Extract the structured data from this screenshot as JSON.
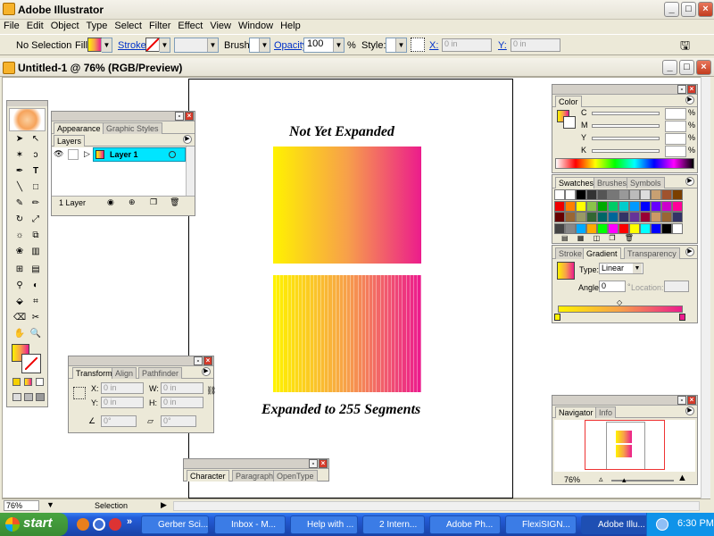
{
  "app": {
    "title": "Adobe Illustrator"
  },
  "menu": [
    "File",
    "Edit",
    "Object",
    "Type",
    "Select",
    "Filter",
    "Effect",
    "View",
    "Window",
    "Help"
  ],
  "control_bar": {
    "selection": "No Selection",
    "fill_label": "Fill:",
    "stroke_label": "Stroke:",
    "brush_label": "Brush:",
    "opacity_label": "Opacity:",
    "opacity_value": "100",
    "percent": "%",
    "style_label": "Style:",
    "x_label": "X:",
    "x_value": "0 in",
    "y_label": "Y:",
    "y_value": "0 in"
  },
  "document": {
    "title": "Untitled-1 @ 76% (RGB/Preview)"
  },
  "artwork": {
    "top_heading": "Not Yet Expanded",
    "bottom_heading": "Expanded to 255 Segments",
    "gradient_colors": [
      "#fff200",
      "#f7a04a",
      "#ec1c8c"
    ],
    "segments": 255
  },
  "appearance_panel": {
    "tabs": [
      "Appearance",
      "Graphic Styles"
    ],
    "sub_tab": "Layers",
    "layer_name": "Layer 1",
    "footer": "1 Layer"
  },
  "transform_panel": {
    "tabs": [
      "Transform",
      "Align",
      "Pathfinder"
    ],
    "x_label": "X:",
    "x_value": "0 in",
    "y_label": "Y:",
    "y_value": "0 in",
    "w_label": "W:",
    "w_value": "0 in",
    "h_label": "H:",
    "h_value": "0 in",
    "angle_value": "0°",
    "shear_value": "0°"
  },
  "character_panel": {
    "tabs": [
      "Character",
      "Paragraph",
      "OpenType"
    ]
  },
  "color_panel": {
    "tab": "Color",
    "channels": [
      "C",
      "M",
      "Y",
      "K"
    ],
    "percent": "%"
  },
  "swatches_panel": {
    "tabs": [
      "Swatches",
      "Brushes",
      "Symbols"
    ]
  },
  "gradient_panel": {
    "tabs": [
      "Stroke",
      "Gradient",
      "Transparency"
    ],
    "type_label": "Type:",
    "type_value": "Linear",
    "angle_label": "Angle:",
    "angle_value": "0",
    "location_label": "Location:"
  },
  "navigator_panel": {
    "tabs": [
      "Navigator",
      "Info"
    ],
    "zoom": "76%"
  },
  "status": {
    "zoom": "76%",
    "tool": "Selection"
  },
  "taskbar": {
    "start": "start",
    "tasks": [
      "Gerber Sci...",
      "Inbox - M...",
      "Help with ...",
      "2 Intern...",
      "Adobe Ph...",
      "FlexiSIGN...",
      "Adobe Illu..."
    ],
    "time": "6:30 PM"
  }
}
